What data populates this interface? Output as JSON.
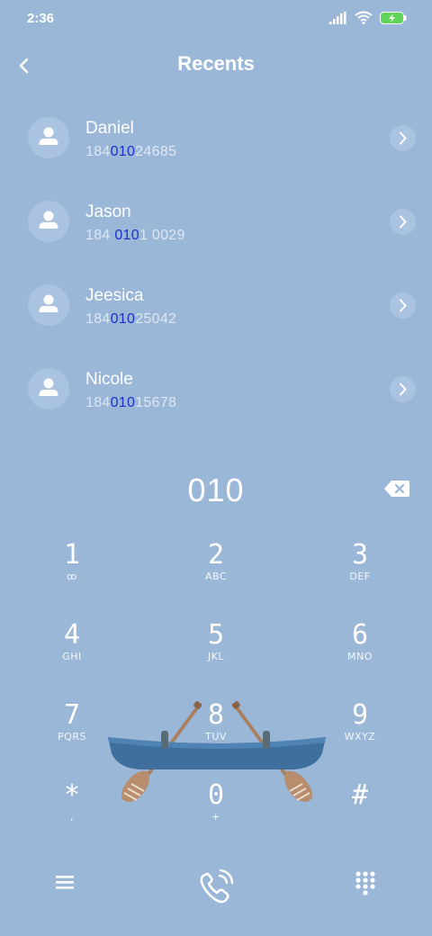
{
  "status": {
    "time": "2:36"
  },
  "header": {
    "title": "Recents"
  },
  "recents": [
    {
      "name": "Daniel",
      "number_pre": "184",
      "number_match": "010",
      "number_post": "24685"
    },
    {
      "name": "Jason",
      "number_pre": "184 ",
      "number_match": "010",
      "number_post": "1 0029"
    },
    {
      "name": "Jeesica",
      "number_pre": "184",
      "number_match": "010",
      "number_post": "25042"
    },
    {
      "name": "Nicole",
      "number_pre": "184",
      "number_match": "010",
      "number_post": "15678"
    }
  ],
  "dialer": {
    "input": "010",
    "keys": [
      {
        "digit": "1",
        "letters": "ꝏ"
      },
      {
        "digit": "2",
        "letters": "ABC"
      },
      {
        "digit": "3",
        "letters": "DEF"
      },
      {
        "digit": "4",
        "letters": "GHI"
      },
      {
        "digit": "5",
        "letters": "JKL"
      },
      {
        "digit": "6",
        "letters": "MNO"
      },
      {
        "digit": "7",
        "letters": "PQRS"
      },
      {
        "digit": "8",
        "letters": "TUV"
      },
      {
        "digit": "9",
        "letters": "WXYZ"
      },
      {
        "digit": "*",
        "letters": ","
      },
      {
        "digit": "0",
        "letters": "+"
      },
      {
        "digit": "#",
        "letters": ""
      }
    ]
  },
  "icons": {
    "back": "chevron-left-icon",
    "backspace": "backspace-icon",
    "menu": "menu-icon",
    "call": "phone-call-icon",
    "keypad": "dialpad-icon"
  },
  "colors": {
    "background": "#9bb7d8",
    "match_highlight": "#1d2fc8",
    "battery": "#5fd35a"
  }
}
